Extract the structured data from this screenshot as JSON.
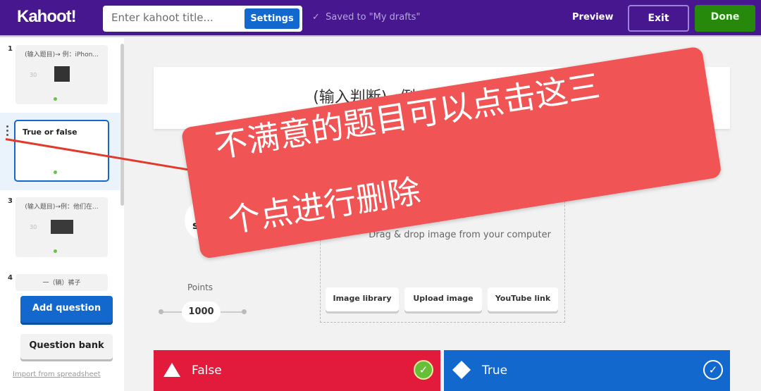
{
  "header": {
    "logo": "Kahoot!",
    "title_placeholder": "Enter kahoot title...",
    "settings_label": "Settings",
    "saved_status": "Saved to \"My drafts\"",
    "preview_label": "Preview",
    "exit_label": "Exit",
    "done_label": "Done",
    "colors": {
      "header": "#46178f",
      "done": "#26890c",
      "settings": "#1368ce"
    }
  },
  "sidebar": {
    "questions": [
      {
        "number": "1",
        "title": "(输入题目)→ 例：iPhon...",
        "time": "30"
      },
      {
        "number": "",
        "title": "True or false"
      },
      {
        "number": "3",
        "title": "(输入题目)→例：他们在...",
        "time": "30"
      },
      {
        "number": "4",
        "title": "一（辆）裤子"
      }
    ],
    "add_question": "Add question",
    "question_bank": "Question bank",
    "import_link": "Import from spreadsheet"
  },
  "editor": {
    "question_title": "(输入判断)→例：他昨天买一条裙子了",
    "time_limit": "30 sec",
    "points_label": "Points",
    "points_value": "1000",
    "media": {
      "drag_text": "Drag & drop image from your computer",
      "buttons": [
        "Image library",
        "Upload image",
        "YouTube link"
      ]
    },
    "answers": [
      {
        "label": "False",
        "shape": "triangle-icon",
        "color": "#e21b3c",
        "correct": true
      },
      {
        "label": "True",
        "shape": "diamond-icon",
        "color": "#1368ce",
        "correct": false
      }
    ]
  },
  "annotation": {
    "line1": "不满意的题目可以点击这三",
    "line2": "个点进行删除",
    "color": "#f05454"
  }
}
